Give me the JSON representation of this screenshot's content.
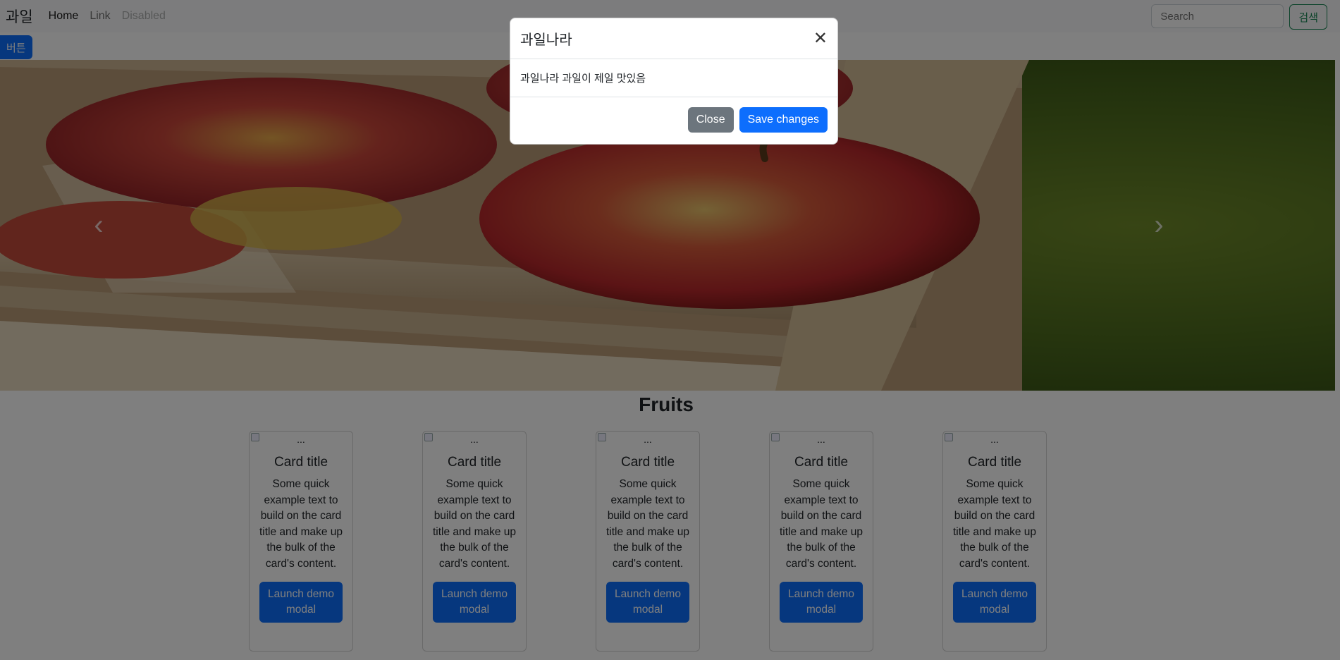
{
  "navbar": {
    "brand": "과일",
    "links": [
      "Home",
      "Link",
      "Disabled"
    ],
    "search_placeholder": "Search",
    "search_button": "검색"
  },
  "top_button": "버튼",
  "carousel": {
    "prev_icon": "chevron-left-icon",
    "next_icon": "chevron-right-icon",
    "prev_glyph": "‹",
    "next_glyph": "›"
  },
  "section": {
    "title": "Fruits"
  },
  "cards": [
    {
      "img_alt": "...",
      "title": "Card title",
      "text": "Some quick example text to build on the card title and make up the bulk of the card's content.",
      "button": "Launch demo modal"
    },
    {
      "img_alt": "...",
      "title": "Card title",
      "text": "Some quick example text to build on the card title and make up the bulk of the card's content.",
      "button": "Launch demo modal"
    },
    {
      "img_alt": "...",
      "title": "Card title",
      "text": "Some quick example text to build on the card title and make up the bulk of the card's content.",
      "button": "Launch demo modal"
    },
    {
      "img_alt": "...",
      "title": "Card title",
      "text": "Some quick example text to build on the card title and make up the bulk of the card's content.",
      "button": "Launch demo modal"
    },
    {
      "img_alt": "...",
      "title": "Card title",
      "text": "Some quick example text to build on the card title and make up the bulk of the card's content.",
      "button": "Launch demo modal"
    }
  ],
  "modal": {
    "title": "과일나라",
    "close_glyph": "✕",
    "body": "과일나라 과일이 제일 맛있음",
    "close_button": "Close",
    "save_button": "Save changes"
  },
  "colors": {
    "primary": "#0d6efd",
    "secondary": "#6c757d",
    "success": "#198754",
    "backdrop": "rgba(0,0,0,0.5)"
  }
}
